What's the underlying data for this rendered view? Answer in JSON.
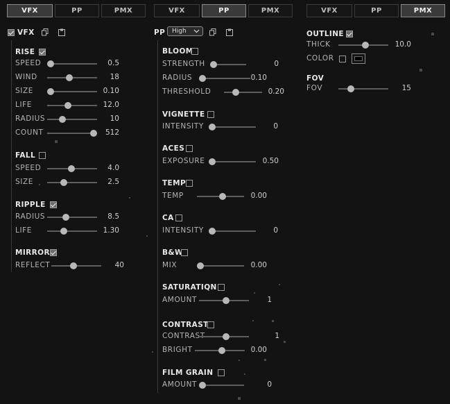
{
  "columns": [
    {
      "id": "vfx",
      "tabs": [
        {
          "label": "VFX",
          "active": true
        },
        {
          "label": "PP",
          "active": false
        },
        {
          "label": "PMX",
          "active": false
        }
      ],
      "header": {
        "label": "VFX",
        "checked": true
      },
      "sections": [
        {
          "title": "RISE",
          "checked": true,
          "rows": [
            {
              "label": "SPEED",
              "value": "0.5",
              "pos": 0.0
            },
            {
              "label": "WIND",
              "value": "18",
              "pos": 0.4
            },
            {
              "label": "SIZE",
              "value": "0.10",
              "pos": 0.0
            },
            {
              "label": "LIFE",
              "value": "12.0",
              "pos": 0.38
            },
            {
              "label": "RADIUS",
              "value": "10",
              "pos": 0.25
            },
            {
              "label": "COUNT",
              "value": "512",
              "pos": 0.94
            }
          ]
        },
        {
          "title": "FALL",
          "checked": false,
          "rows": [
            {
              "label": "SPEED",
              "value": "4.0",
              "pos": 0.45
            },
            {
              "label": "SIZE",
              "value": "2.5",
              "pos": 0.28
            }
          ]
        },
        {
          "title": "RIPPLE",
          "checked": true,
          "rows": [
            {
              "label": "RADIUS",
              "value": "8.5",
              "pos": 0.33
            },
            {
              "label": "LIFE",
              "value": "1.30",
              "pos": 0.29
            }
          ]
        },
        {
          "title": "MIRROR",
          "checked": true,
          "rows": [
            {
              "label": "REFLECT",
              "value": "40",
              "pos": 0.4
            }
          ]
        }
      ]
    },
    {
      "id": "pp",
      "tabs": [
        {
          "label": "VFX",
          "active": false
        },
        {
          "label": "PP",
          "active": true
        },
        {
          "label": "PMX",
          "active": false
        }
      ],
      "header": {
        "label": "PP",
        "dropdown": "High"
      },
      "sections": [
        {
          "title": "BLOOM",
          "checked": false,
          "rows": [
            {
              "label": "STRENGTH",
              "value": "0",
              "pos": 0.0
            },
            {
              "label": "RADIUS",
              "value": "0.10",
              "pos": 0.0
            },
            {
              "label": "THRESHOLD",
              "value": "0.20",
              "pos": 0.23
            }
          ]
        },
        {
          "title": "VIGNETTE",
          "checked": false,
          "rows": [
            {
              "label": "INTENSITY",
              "value": "0",
              "pos": 0.0
            }
          ]
        },
        {
          "title": "ACES",
          "checked": false,
          "rows": [
            {
              "label": "EXPOSURE",
              "value": "0.50",
              "pos": 0.0
            }
          ]
        },
        {
          "title": "TEMP",
          "checked": false,
          "rows": [
            {
              "label": "TEMP",
              "value": "0.00",
              "pos": 0.5
            }
          ]
        },
        {
          "title": "CA",
          "checked": false,
          "rows": [
            {
              "label": "INTENSITY",
              "value": "0",
              "pos": 0.0
            }
          ]
        },
        {
          "title": "B&W",
          "checked": false,
          "rows": [
            {
              "label": "MIX",
              "value": "0.00",
              "pos": 0.0
            }
          ]
        },
        {
          "title": "SATURATIQN",
          "checked": false,
          "rows": [
            {
              "label": "AMOUNT",
              "value": "1",
              "pos": 0.5
            }
          ]
        },
        {
          "title": "CONTRAST",
          "checked": false,
          "rows": [
            {
              "label": "CONTRAST",
              "value": "1",
              "pos": 0.5
            },
            {
              "label": "BRIGHT",
              "value": "0.00",
              "pos": 0.5
            }
          ]
        },
        {
          "title": "FILM GRAIN",
          "checked": false,
          "rows": [
            {
              "label": "AMOUNT",
              "value": "0",
              "pos": 0.0
            }
          ]
        }
      ]
    },
    {
      "id": "pmx",
      "tabs": [
        {
          "label": "VFX",
          "active": false
        },
        {
          "label": "PP",
          "active": false
        },
        {
          "label": "PMX",
          "active": true
        }
      ],
      "sections": [
        {
          "title": "OUTLINE",
          "checked": true,
          "rows": [
            {
              "label": "THICK",
              "value": "10.0",
              "pos": 0.5
            },
            {
              "label": "COLOR",
              "type": "color",
              "checked": false
            }
          ]
        },
        {
          "title": "FOV",
          "rows": [
            {
              "label": "FOV",
              "value": "15",
              "pos": 0.2
            }
          ]
        }
      ]
    }
  ],
  "colors": {
    "background": "#131313",
    "accent": "#b8b8b8"
  }
}
